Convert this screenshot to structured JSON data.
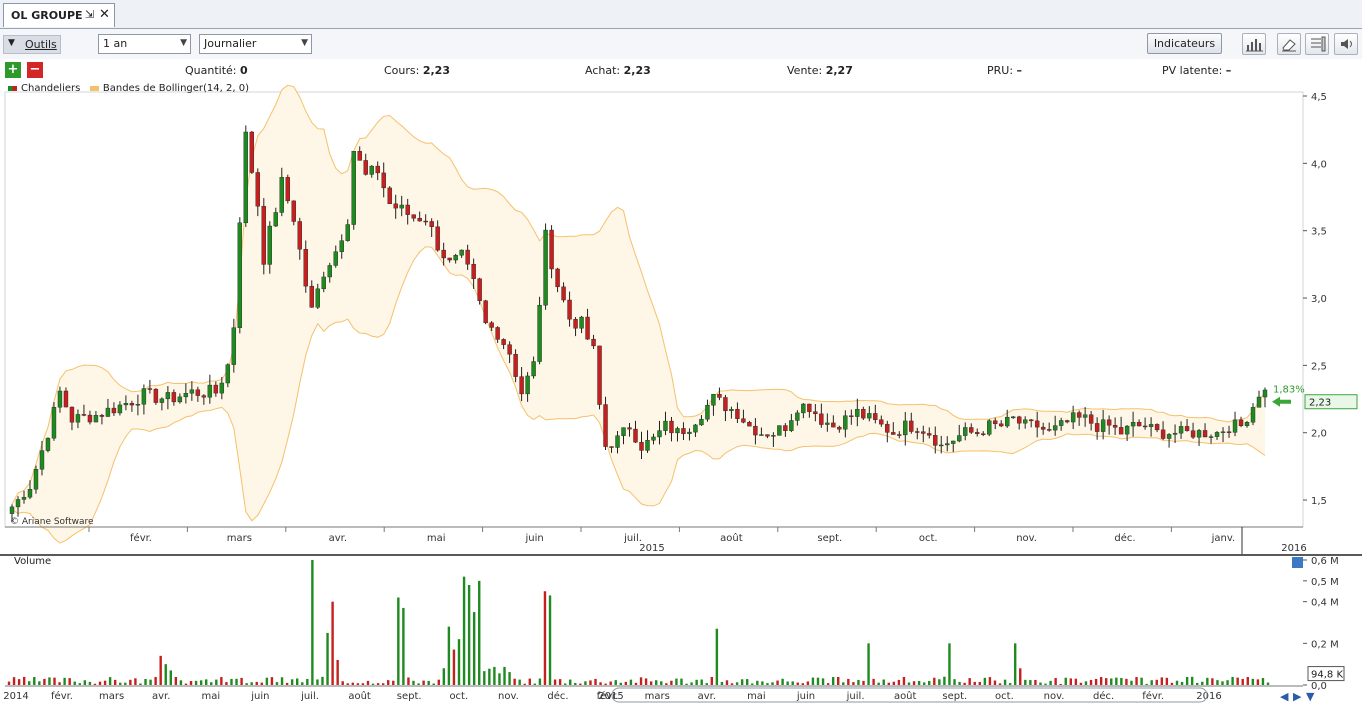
{
  "tab": {
    "title": "OL GROUPE",
    "pin_glyph": "⇲",
    "close_glyph": "✕"
  },
  "toolbar": {
    "tools_label": "Outils",
    "period": "1 an",
    "interval": "Journalier",
    "indicators_label": "Indicateurs",
    "icons": [
      "histogram-icon",
      "eraser-icon",
      "layout-icon",
      "speaker-icon"
    ]
  },
  "info": {
    "plus": "+",
    "minus": "−",
    "quantity_label": "Quantité:",
    "quantity": "0",
    "cours_label": "Cours:",
    "cours": "2,23",
    "achat_label": "Achat:",
    "achat": "2,23",
    "vente_label": "Vente:",
    "vente": "2,27",
    "pru_label": "PRU:",
    "pru": "–",
    "pv_label": "PV latente:",
    "pv": "–"
  },
  "legend": {
    "candles": "Chandeliers",
    "bollinger": "Bandes de Bollinger(14, 2, 0)",
    "colors": {
      "up": "#1f8a1f",
      "down": "#c42020",
      "band": "#f5c16c",
      "band_fill": "#fef6e6"
    }
  },
  "copyright": "© Ariane Software",
  "price_badge": {
    "value": "2,23",
    "change": "1,83%"
  },
  "volume_panel": {
    "title": "Volume",
    "current": "94,8 K"
  },
  "chart_data": {
    "type": "candlestick",
    "title": "",
    "price_axis": {
      "ylim": [
        1.3,
        4.5
      ],
      "ticks": [
        "4,5",
        "4,0",
        "3,5",
        "3,0",
        "2,5",
        "2,0",
        "1,5"
      ]
    },
    "x_months": [
      "févr.",
      "mars",
      "avr.",
      "mai",
      "juin",
      "juil.",
      "août",
      "sept.",
      "oct.",
      "nov.",
      "déc.",
      "janv."
    ],
    "x_years": [
      "2015",
      "2016"
    ],
    "price_path": [
      [
        0,
        1.45
      ],
      [
        3,
        1.6
      ],
      [
        6,
        2.0
      ],
      [
        8,
        2.3
      ],
      [
        10,
        2.1
      ],
      [
        14,
        2.13
      ],
      [
        18,
        2.2
      ],
      [
        22,
        2.28
      ],
      [
        26,
        2.25
      ],
      [
        30,
        2.3
      ],
      [
        34,
        2.3
      ],
      [
        36,
        2.5
      ],
      [
        37,
        2.8
      ],
      [
        38,
        3.6
      ],
      [
        39,
        4.2
      ],
      [
        41,
        3.7
      ],
      [
        42,
        3.3
      ],
      [
        45,
        3.85
      ],
      [
        47,
        3.6
      ],
      [
        49,
        3.1
      ],
      [
        50,
        2.9
      ],
      [
        52,
        3.2
      ],
      [
        54,
        3.35
      ],
      [
        56,
        3.6
      ],
      [
        57,
        4.1
      ],
      [
        59,
        3.9
      ],
      [
        61,
        3.95
      ],
      [
        63,
        3.7
      ],
      [
        65,
        3.65
      ],
      [
        67,
        3.6
      ],
      [
        69,
        3.6
      ],
      [
        71,
        3.4
      ],
      [
        73,
        3.25
      ],
      [
        75,
        3.3
      ],
      [
        77,
        3.1
      ],
      [
        79,
        2.8
      ],
      [
        81,
        2.75
      ],
      [
        83,
        2.6
      ],
      [
        85,
        2.3
      ],
      [
        87,
        2.5
      ],
      [
        89,
        3.45
      ],
      [
        91,
        3.1
      ],
      [
        93,
        2.85
      ],
      [
        95,
        2.8
      ],
      [
        97,
        2.6
      ],
      [
        98,
        2.2
      ],
      [
        99,
        1.9
      ],
      [
        101,
        1.95
      ],
      [
        103,
        2.05
      ],
      [
        105,
        1.9
      ],
      [
        107,
        1.95
      ],
      [
        109,
        2.05
      ],
      [
        111,
        2.0
      ],
      [
        113,
        2.05
      ],
      [
        115,
        2.15
      ],
      [
        117,
        2.25
      ],
      [
        119,
        2.2
      ],
      [
        121,
        2.15
      ],
      [
        123,
        2.05
      ],
      [
        125,
        2.0
      ],
      [
        127,
        2.0
      ],
      [
        129,
        2.05
      ],
      [
        131,
        2.2
      ],
      [
        133,
        2.2
      ],
      [
        135,
        2.1
      ],
      [
        137,
        2.05
      ],
      [
        139,
        2.1
      ],
      [
        141,
        2.15
      ],
      [
        143,
        2.1
      ],
      [
        145,
        2.05
      ],
      [
        147,
        2.0
      ],
      [
        149,
        2.05
      ],
      [
        151,
        2.05
      ],
      [
        153,
        2.0
      ],
      [
        155,
        1.9
      ],
      [
        157,
        1.95
      ],
      [
        159,
        2.0
      ],
      [
        161,
        2.0
      ],
      [
        163,
        2.05
      ],
      [
        165,
        2.05
      ],
      [
        167,
        2.1
      ],
      [
        169,
        2.05
      ],
      [
        171,
        2.05
      ],
      [
        173,
        2.0
      ],
      [
        175,
        2.05
      ],
      [
        177,
        2.1
      ],
      [
        179,
        2.1
      ],
      [
        181,
        2.05
      ],
      [
        183,
        2.05
      ],
      [
        185,
        2.0
      ],
      [
        187,
        2.05
      ],
      [
        189,
        2.05
      ],
      [
        191,
        2.0
      ],
      [
        193,
        2.0
      ],
      [
        195,
        2.0
      ],
      [
        197,
        2.0
      ],
      [
        199,
        2.0
      ],
      [
        201,
        2.0
      ],
      [
        203,
        2.05
      ],
      [
        205,
        2.05
      ],
      [
        207,
        2.2
      ],
      [
        208,
        2.3
      ]
    ],
    "volume_axis": {
      "ylim": [
        0,
        0.6
      ],
      "ticks": [
        "0,6 M",
        "0,5 M",
        "0,4 M",
        "0,2 M",
        "0,0"
      ],
      "unit": "M"
    },
    "volume_months": [
      "févr.",
      "mars",
      "avr.",
      "mai",
      "juin",
      "juil.",
      "août",
      "sept.",
      "oct.",
      "nov.",
      "déc.",
      "févr.",
      "mars",
      "avr.",
      "mai",
      "juin",
      "juil.",
      "août",
      "sept.",
      "oct.",
      "nov.",
      "déc.",
      "févr."
    ],
    "volume_years": [
      "2014",
      "2015",
      "2016"
    ],
    "volume_spikes": [
      [
        30,
        0.14
      ],
      [
        31,
        0.1
      ],
      [
        32,
        0.07
      ],
      [
        60,
        0.6
      ],
      [
        63,
        0.25
      ],
      [
        64,
        0.4
      ],
      [
        65,
        0.12
      ],
      [
        77,
        0.42
      ],
      [
        78,
        0.37
      ],
      [
        87,
        0.28
      ],
      [
        88,
        0.17
      ],
      [
        89,
        0.22
      ],
      [
        90,
        0.52
      ],
      [
        91,
        0.48
      ],
      [
        92,
        0.35
      ],
      [
        93,
        0.5
      ],
      [
        106,
        0.45
      ],
      [
        107,
        0.43
      ],
      [
        140,
        0.27
      ],
      [
        170,
        0.2
      ],
      [
        186,
        0.2
      ],
      [
        199,
        0.2
      ],
      [
        200,
        0.08
      ]
    ]
  }
}
